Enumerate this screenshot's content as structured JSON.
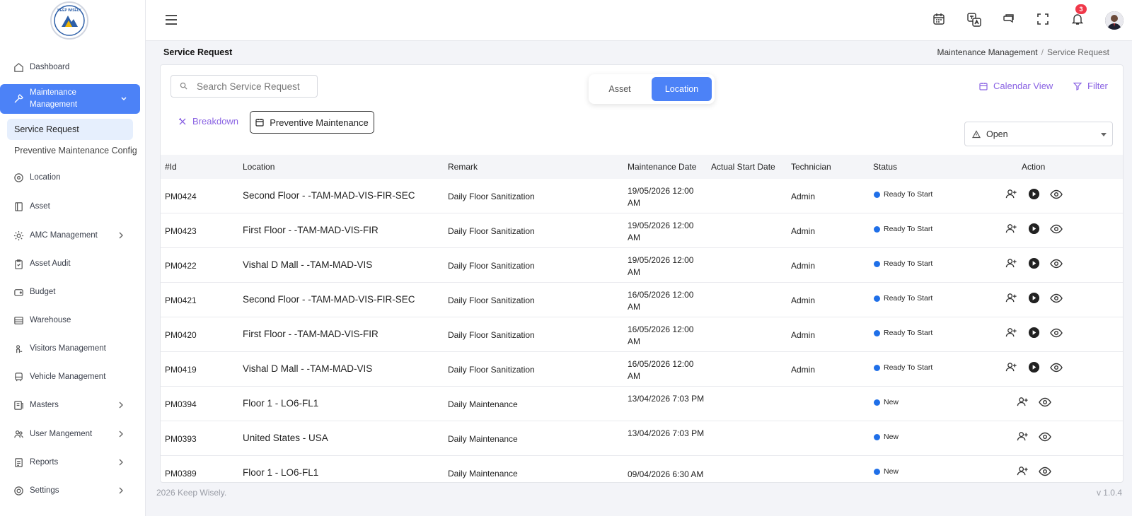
{
  "app": {
    "brand": "KEEP WISELY"
  },
  "sidebar": {
    "items": [
      {
        "label": "Dashboard",
        "icon": "home-icon"
      },
      {
        "label": "Maintenance Management",
        "icon": "wrench-icon"
      },
      {
        "label": "Location",
        "icon": "location-icon"
      },
      {
        "label": "Asset",
        "icon": "asset-icon"
      },
      {
        "label": "AMC Management",
        "icon": "gear-icon"
      },
      {
        "label": "Asset Audit",
        "icon": "clipboard-icon"
      },
      {
        "label": "Budget",
        "icon": "wallet-icon"
      },
      {
        "label": "Warehouse",
        "icon": "warehouse-icon"
      },
      {
        "label": "Visitors Management",
        "icon": "visitor-icon"
      },
      {
        "label": "Vehicle Management",
        "icon": "vehicle-icon"
      },
      {
        "label": "Masters",
        "icon": "masters-icon"
      },
      {
        "label": "User Mangement",
        "icon": "users-icon"
      },
      {
        "label": "Reports",
        "icon": "report-icon"
      },
      {
        "label": "Settings",
        "icon": "settings-icon"
      }
    ],
    "sub_items": [
      {
        "label": "Service Request"
      },
      {
        "label": "Preventive Maintenance Config"
      }
    ]
  },
  "topbar": {
    "notification_count": "3"
  },
  "page": {
    "title": "Service Request",
    "breadcrumb": [
      "Maintenance Management",
      "Service Request"
    ]
  },
  "controls": {
    "search_placeholder": "Search Service Request",
    "segment": {
      "asset": "Asset",
      "location": "Location"
    },
    "calendar_view": "Calendar View",
    "filter": "Filter",
    "breakdown": "Breakdown",
    "preventive": "Preventive Maintenance",
    "status_selected": "Open"
  },
  "table": {
    "headers": [
      "#Id",
      "Location",
      "Remark",
      "Maintenance Date",
      "Actual Start Date",
      "Technician",
      "Status",
      "Action"
    ],
    "rows": [
      {
        "id": "PM0424",
        "location": "Second Floor - -TAM-MAD-VIS-FIR-SEC",
        "remark": "Daily Floor Sanitization",
        "date": "19/05/2026 12:00 AM",
        "start": "",
        "tech": "Admin",
        "status": "Ready To Start"
      },
      {
        "id": "PM0423",
        "location": "First Floor - -TAM-MAD-VIS-FIR",
        "remark": "Daily Floor Sanitization",
        "date": "19/05/2026 12:00 AM",
        "start": "",
        "tech": "Admin",
        "status": "Ready To Start"
      },
      {
        "id": "PM0422",
        "location": "Vishal D Mall - -TAM-MAD-VIS",
        "remark": "Daily Floor Sanitization",
        "date": "19/05/2026 12:00 AM",
        "start": "",
        "tech": "Admin",
        "status": "Ready To Start"
      },
      {
        "id": "PM0421",
        "location": "Second Floor - -TAM-MAD-VIS-FIR-SEC",
        "remark": "Daily Floor Sanitization",
        "date": "16/05/2026 12:00 AM",
        "start": "",
        "tech": "Admin",
        "status": "Ready To Start"
      },
      {
        "id": "PM0420",
        "location": "First Floor - -TAM-MAD-VIS-FIR",
        "remark": "Daily Floor Sanitization",
        "date": "16/05/2026 12:00 AM",
        "start": "",
        "tech": "Admin",
        "status": "Ready To Start"
      },
      {
        "id": "PM0419",
        "location": "Vishal D Mall - -TAM-MAD-VIS",
        "remark": "Daily Floor Sanitization",
        "date": "16/05/2026 12:00 AM",
        "start": "",
        "tech": "Admin",
        "status": "Ready To Start"
      },
      {
        "id": "PM0394",
        "location": "Floor 1 - LO6-FL1",
        "remark": "Daily Maintenance",
        "date": "13/04/2026 7:03 PM",
        "start": "",
        "tech": "",
        "status": "New"
      },
      {
        "id": "PM0393",
        "location": "United States - USA",
        "remark": "Daily Maintenance",
        "date": "13/04/2026 7:03 PM",
        "start": "",
        "tech": "",
        "status": "New"
      },
      {
        "id": "PM0389",
        "location": "Floor 1 - LO6-FL1",
        "remark": "Daily Maintenance",
        "date": "09/04/2026 6:30 AM",
        "start": "",
        "tech": "",
        "status": "New"
      }
    ]
  },
  "footer": {
    "copyright": "2026 Keep Wisely.",
    "version": "v 1.0.4"
  }
}
